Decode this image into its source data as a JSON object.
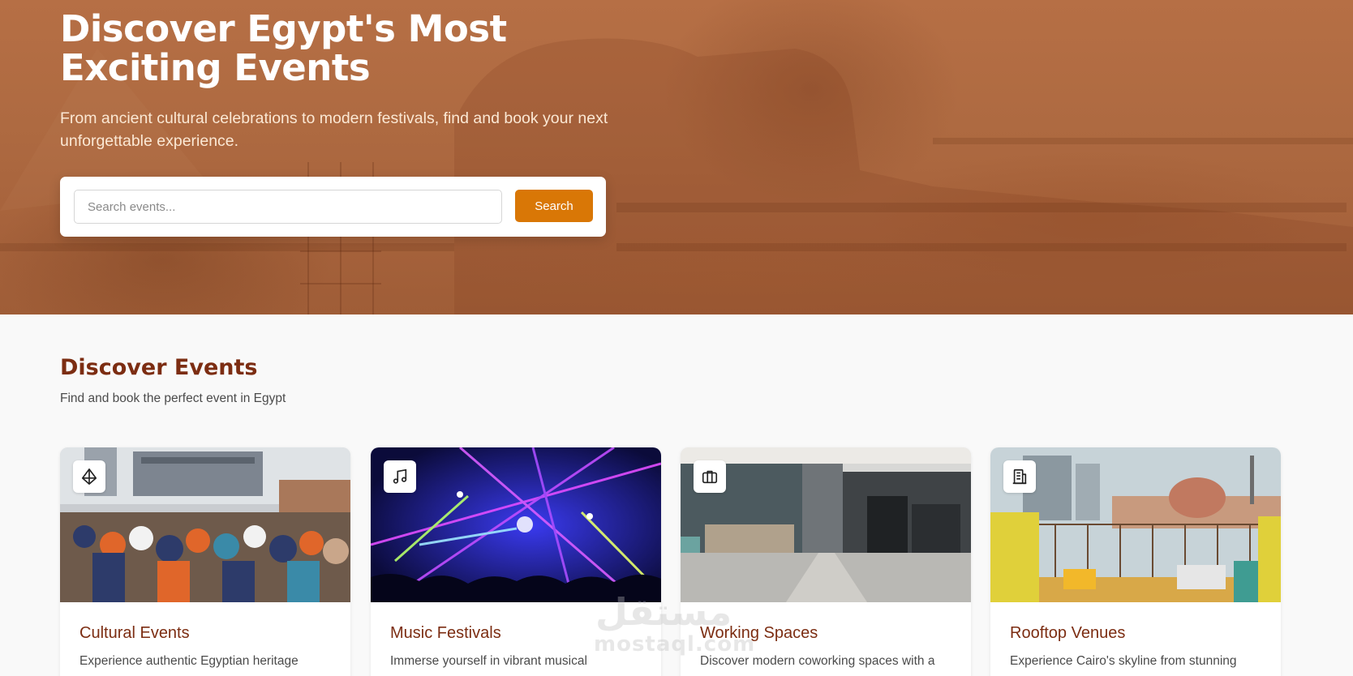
{
  "hero": {
    "title": "Discover Egypt's Most Exciting Events",
    "subtitle": "From ancient cultural celebrations to modern festivals, find and book your next unforgettable experience.",
    "search": {
      "placeholder": "Search events...",
      "value": "",
      "button_label": "Search"
    }
  },
  "section": {
    "title": "Discover Events",
    "subtitle": "Find and book the perfect event in Egypt"
  },
  "cards": [
    {
      "title": "Cultural Events",
      "description": "Experience authentic Egyptian heritage",
      "icon": "pyramid-icon"
    },
    {
      "title": "Music Festivals",
      "description": "Immerse yourself in vibrant musical",
      "icon": "music-note-icon"
    },
    {
      "title": "Working Spaces",
      "description": "Discover modern coworking spaces with a",
      "icon": "briefcase-icon"
    },
    {
      "title": "Rooftop Venues",
      "description": "Experience Cairo's skyline from stunning",
      "icon": "building-icon"
    }
  ],
  "watermark": {
    "arabic": "مستقل",
    "latin": "mostaql.com"
  },
  "colors": {
    "accent": "#d97706",
    "heading": "#7c2d12",
    "hero_overlay": "#b06a41"
  }
}
